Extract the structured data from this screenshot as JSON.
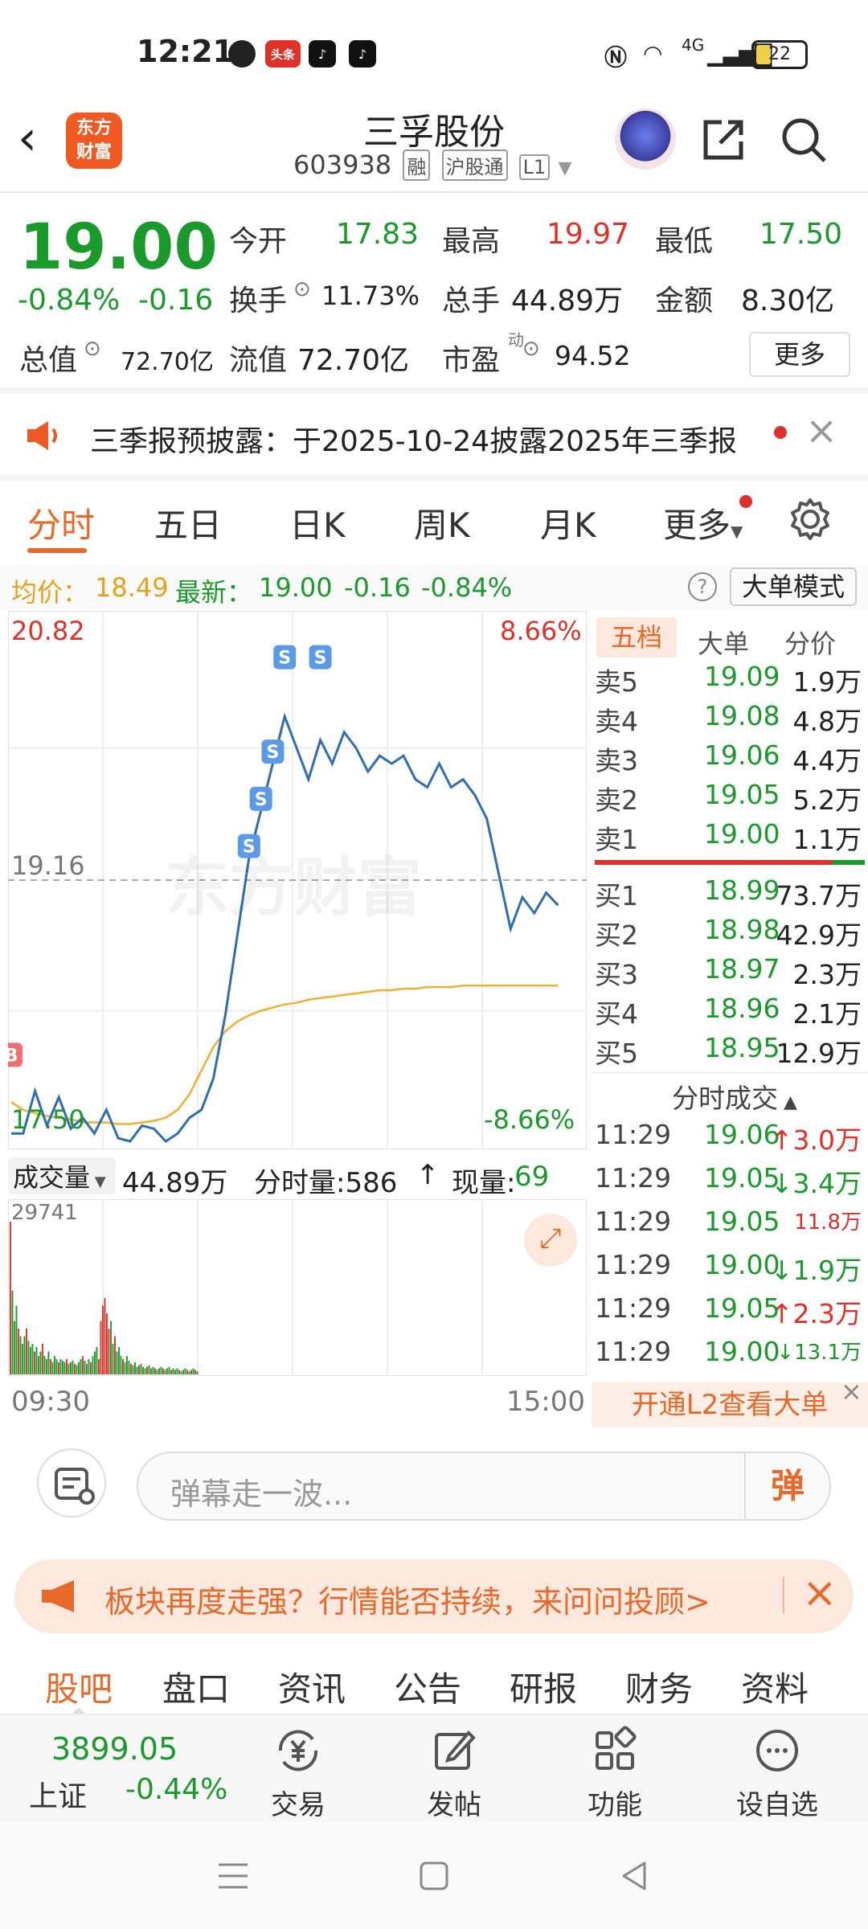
{
  "status_bar": {
    "time": "12:21",
    "apps": [
      "头条"
    ],
    "network": "4G",
    "battery": "22"
  },
  "header": {
    "logo_text": "东方财富",
    "title": "三孚股份",
    "code": "603938",
    "tags": [
      "融",
      "沪股通",
      "L1"
    ]
  },
  "quote": {
    "price": "19.00",
    "change_pct": "-0.84%",
    "change": "-0.16",
    "open_label": "今开",
    "open": "17.83",
    "high_label": "最高",
    "high": "19.97",
    "low_label": "最低",
    "low": "17.50",
    "turnover_label": "换手",
    "turnover": "11.73%",
    "volume_label": "总手",
    "volume": "44.89万",
    "amount_label": "金额",
    "amount": "8.30亿",
    "mktcap_label": "总值",
    "mktcap": "72.70亿",
    "float_label": "流值",
    "float": "72.70亿",
    "pe_label": "市盈",
    "pe_sup": "动",
    "pe": "94.52",
    "more": "更多"
  },
  "notice": {
    "text": "三季报预披露：于2025-10-24披露2025年三季报"
  },
  "tabs": [
    "分时",
    "五日",
    "日K",
    "周K",
    "月K",
    "更多"
  ],
  "info_line": {
    "avg_label": "均价：",
    "avg": "18.49",
    "latest_label": "最新：",
    "latest": "19.00",
    "chg": "-0.16",
    "chg_pct": "-0.84%",
    "mode_btn": "大单模式"
  },
  "chart_data": {
    "type": "line",
    "title": "",
    "y_max": "20.82",
    "y_max_pct": "8.66%",
    "y_mid": "19.16",
    "y_min": "17.50",
    "y_min_pct": "-8.66%",
    "ylim": [
      17.5,
      20.82
    ],
    "x_start": "09:30",
    "x_end": "15:00",
    "watermark": "东方财富",
    "series": [
      {
        "name": "",
        "values": [
          17.55,
          17.55,
          17.82,
          17.6,
          17.78,
          17.58,
          17.65,
          17.55,
          17.7,
          17.52,
          17.5,
          17.6,
          17.58,
          17.5,
          17.55,
          17.65,
          17.7,
          17.9,
          18.3,
          18.8,
          19.3,
          19.6,
          19.9,
          20.2,
          20.0,
          19.8,
          20.05,
          19.9,
          20.1,
          20.0,
          19.85,
          19.95,
          19.9,
          19.95,
          19.8,
          19.75,
          19.9,
          19.75,
          19.8,
          19.7,
          19.55,
          19.2,
          18.85,
          19.05,
          18.95,
          19.08,
          19.0
        ]
      },
      {
        "name": "",
        "values": [
          17.75,
          17.7,
          17.68,
          17.66,
          17.65,
          17.64,
          17.62,
          17.62,
          17.62,
          17.61,
          17.61,
          17.62,
          17.63,
          17.65,
          17.7,
          17.8,
          17.95,
          18.1,
          18.2,
          18.26,
          18.3,
          18.33,
          18.35,
          18.37,
          18.38,
          18.4,
          18.41,
          18.42,
          18.43,
          18.44,
          18.45,
          18.46,
          18.46,
          18.47,
          18.47,
          18.48,
          18.48,
          18.48,
          18.49,
          18.49,
          18.49,
          18.49,
          18.49,
          18.49,
          18.49,
          18.49,
          18.49
        ]
      }
    ],
    "markers": [
      "B",
      "S",
      "S",
      "S",
      "S",
      "S"
    ]
  },
  "volume": {
    "label": "成交量",
    "total": "44.89万",
    "tick_label": "分时量:586",
    "now_label": "现量:",
    "now": "69",
    "max": "29741",
    "bars": [
      1.0,
      0.55,
      0.35,
      0.45,
      0.3,
      0.25,
      0.2,
      0.25,
      0.3,
      0.22,
      0.18,
      0.2,
      0.15,
      0.18,
      0.12,
      0.15,
      0.2,
      0.12,
      0.1,
      0.15,
      0.1,
      0.08,
      0.12,
      0.1,
      0.08,
      0.1,
      0.09,
      0.08,
      0.1,
      0.07,
      0.08,
      0.09,
      0.07,
      0.06,
      0.08,
      0.1,
      0.12,
      0.09,
      0.07,
      0.1,
      0.08,
      0.12,
      0.15,
      0.18,
      0.1,
      0.35,
      0.45,
      0.5,
      0.4,
      0.3,
      0.35,
      0.2,
      0.25,
      0.15,
      0.18,
      0.12,
      0.1,
      0.08,
      0.12,
      0.09,
      0.07,
      0.06,
      0.08,
      0.05,
      0.06,
      0.07,
      0.05,
      0.04,
      0.05,
      0.06,
      0.04,
      0.05,
      0.04,
      0.03,
      0.04,
      0.05,
      0.04,
      0.03,
      0.04,
      0.05,
      0.03,
      0.04,
      0.03,
      0.04,
      0.03,
      0.02,
      0.03,
      0.04,
      0.03,
      0.02,
      0.03,
      0.04,
      0.03,
      0.02
    ],
    "red_index": [
      44,
      45,
      46,
      47,
      48,
      49
    ]
  },
  "depth": {
    "tabs": [
      "五档",
      "大单",
      "分价"
    ],
    "asks": [
      {
        "label": "卖5",
        "price": "19.09",
        "vol": "1.9万"
      },
      {
        "label": "卖4",
        "price": "19.08",
        "vol": "4.8万"
      },
      {
        "label": "卖3",
        "price": "19.06",
        "vol": "4.4万"
      },
      {
        "label": "卖2",
        "price": "19.05",
        "vol": "5.2万"
      },
      {
        "label": "卖1",
        "price": "19.00",
        "vol": "1.1万"
      }
    ],
    "bids": [
      {
        "label": "买1",
        "price": "18.99",
        "vol": "73.7万"
      },
      {
        "label": "买2",
        "price": "18.98",
        "vol": "42.9万"
      },
      {
        "label": "买3",
        "price": "18.97",
        "vol": "2.3万"
      },
      {
        "label": "买4",
        "price": "18.96",
        "vol": "2.1万"
      },
      {
        "label": "买5",
        "price": "18.95",
        "vol": "12.9万"
      }
    ],
    "trades_title": "分时成交",
    "trades": [
      {
        "time": "11:29",
        "price": "19.06",
        "dir": "↑",
        "vol": "3.0万",
        "color": "#e0302a"
      },
      {
        "time": "11:29",
        "price": "19.05",
        "dir": "↓",
        "vol": "3.4万",
        "color": "#1a9a2a"
      },
      {
        "time": "11:29",
        "price": "19.05",
        "dir": "",
        "vol": "11.8万",
        "color": "#e0302a"
      },
      {
        "time": "11:29",
        "price": "19.00",
        "dir": "↓",
        "vol": "1.9万",
        "color": "#1a9a2a"
      },
      {
        "time": "11:29",
        "price": "19.05",
        "dir": "↑",
        "vol": "2.3万",
        "color": "#e0302a"
      },
      {
        "time": "11:29",
        "price": "19.00",
        "dir": "↓",
        "vol": "13.1万",
        "color": "#1a9a2a"
      }
    ],
    "l2_text": "开通L2查看大单"
  },
  "comment": {
    "placeholder": "弹幕走一波...",
    "btn": "弹"
  },
  "promo": {
    "text": "板块再度走强？行情能否持续，来问问投顾>"
  },
  "subtabs": [
    "股吧",
    "盘口",
    "资讯",
    "公告",
    "研报",
    "财务",
    "资料"
  ],
  "footer": {
    "index_value": "3899.05",
    "index_name": "上证",
    "index_chg": "-0.44%",
    "items": [
      "交易",
      "发帖",
      "功能",
      "设自选"
    ]
  },
  "colors": {
    "accent": "#e8692a",
    "up": "#e0302a",
    "down": "#1a9a2a",
    "price_line": "#2f6db5",
    "avg_line": "#f0b030"
  }
}
